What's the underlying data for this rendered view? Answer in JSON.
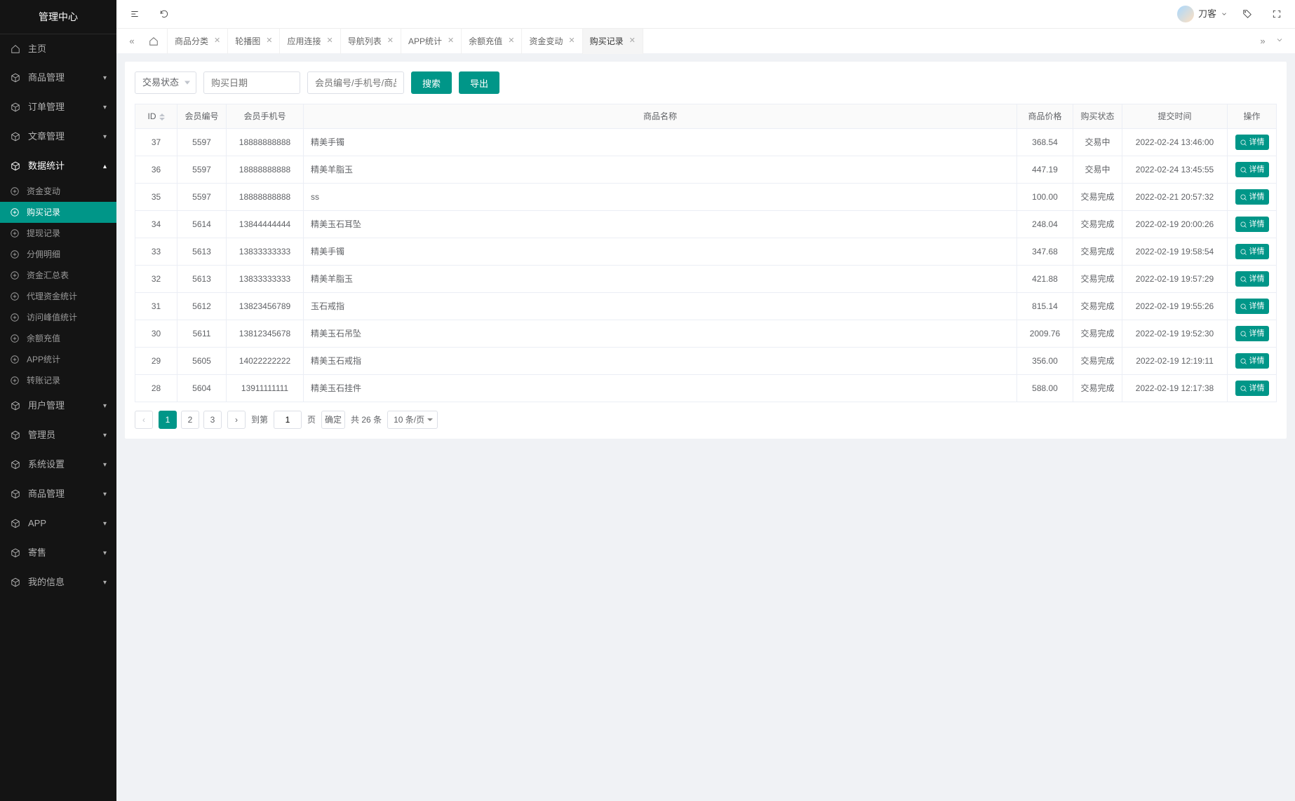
{
  "logo": "管理中心",
  "user_name": "刀客",
  "sidebar": [
    {
      "icon": "home",
      "label": "主页",
      "type": "top"
    },
    {
      "icon": "cube",
      "label": "商品管理",
      "type": "group",
      "arrow": true
    },
    {
      "icon": "cube",
      "label": "订单管理",
      "type": "group",
      "arrow": true
    },
    {
      "icon": "cube",
      "label": "文章管理",
      "type": "group",
      "arrow": true
    },
    {
      "icon": "cube",
      "label": "数据统计",
      "type": "group",
      "arrow": true,
      "open": true,
      "children": [
        {
          "label": "资金变动"
        },
        {
          "label": "购买记录",
          "active": true
        },
        {
          "label": "提现记录"
        },
        {
          "label": "分佣明细"
        },
        {
          "label": "资金汇总表"
        },
        {
          "label": "代理资金统计"
        },
        {
          "label": "访问峰值统计"
        },
        {
          "label": "余额充值"
        },
        {
          "label": "APP统计"
        },
        {
          "label": "转账记录"
        }
      ]
    },
    {
      "icon": "cube",
      "label": "用户管理",
      "type": "group",
      "arrow": true
    },
    {
      "icon": "cube",
      "label": "管理员",
      "type": "group",
      "arrow": true
    },
    {
      "icon": "cube",
      "label": "系统设置",
      "type": "group",
      "arrow": true
    },
    {
      "icon": "cube",
      "label": "商品管理",
      "type": "group",
      "arrow": true
    },
    {
      "icon": "cube",
      "label": "APP",
      "type": "group",
      "arrow": true
    },
    {
      "icon": "cube",
      "label": "寄售",
      "type": "group",
      "arrow": true
    },
    {
      "icon": "cube",
      "label": "我的信息",
      "type": "group",
      "arrow": true
    }
  ],
  "tabs": [
    "商品分类",
    "轮播图",
    "应用连接",
    "导航列表",
    "APP统计",
    "余额充值",
    "资金变动",
    "购买记录"
  ],
  "filters": {
    "status_label": "交易状态",
    "date_placeholder": "购买日期",
    "keyword_placeholder": "会员编号/手机号/商品名称",
    "search": "搜索",
    "export": "导出"
  },
  "columns": {
    "id": "ID",
    "member": "会员编号",
    "phone": "会员手机号",
    "product": "商品名称",
    "price": "商品价格",
    "status": "购买状态",
    "time": "提交时间",
    "op": "操作"
  },
  "detail_label": "详情",
  "rows": [
    {
      "id": "37",
      "member": "5597",
      "phone": "18888888888",
      "product": "精美手镯",
      "price": "368.54",
      "status": "交易中",
      "time": "2022-02-24 13:46:00"
    },
    {
      "id": "36",
      "member": "5597",
      "phone": "18888888888",
      "product": "精美羊脂玉",
      "price": "447.19",
      "status": "交易中",
      "time": "2022-02-24 13:45:55"
    },
    {
      "id": "35",
      "member": "5597",
      "phone": "18888888888",
      "product": "ss",
      "price": "100.00",
      "status": "交易完成",
      "time": "2022-02-21 20:57:32"
    },
    {
      "id": "34",
      "member": "5614",
      "phone": "13844444444",
      "product": "精美玉石耳坠",
      "price": "248.04",
      "status": "交易完成",
      "time": "2022-02-19 20:00:26"
    },
    {
      "id": "33",
      "member": "5613",
      "phone": "13833333333",
      "product": "精美手镯",
      "price": "347.68",
      "status": "交易完成",
      "time": "2022-02-19 19:58:54"
    },
    {
      "id": "32",
      "member": "5613",
      "phone": "13833333333",
      "product": "精美羊脂玉",
      "price": "421.88",
      "status": "交易完成",
      "time": "2022-02-19 19:57:29"
    },
    {
      "id": "31",
      "member": "5612",
      "phone": "13823456789",
      "product": "玉石戒指",
      "price": "815.14",
      "status": "交易完成",
      "time": "2022-02-19 19:55:26"
    },
    {
      "id": "30",
      "member": "5611",
      "phone": "13812345678",
      "product": "精美玉石吊坠",
      "price": "2009.76",
      "status": "交易完成",
      "time": "2022-02-19 19:52:30"
    },
    {
      "id": "29",
      "member": "5605",
      "phone": "14022222222",
      "product": "精美玉石戒指",
      "price": "356.00",
      "status": "交易完成",
      "time": "2022-02-19 12:19:11"
    },
    {
      "id": "28",
      "member": "5604",
      "phone": "13911111111",
      "product": "精美玉石挂件",
      "price": "588.00",
      "status": "交易完成",
      "time": "2022-02-19 12:17:38"
    }
  ],
  "pager": {
    "goto": "到第",
    "page_unit": "页",
    "confirm": "确定",
    "total": "共 26 条",
    "size": "10 条/页",
    "pages": [
      "1",
      "2",
      "3"
    ],
    "current": "1",
    "input": "1"
  }
}
